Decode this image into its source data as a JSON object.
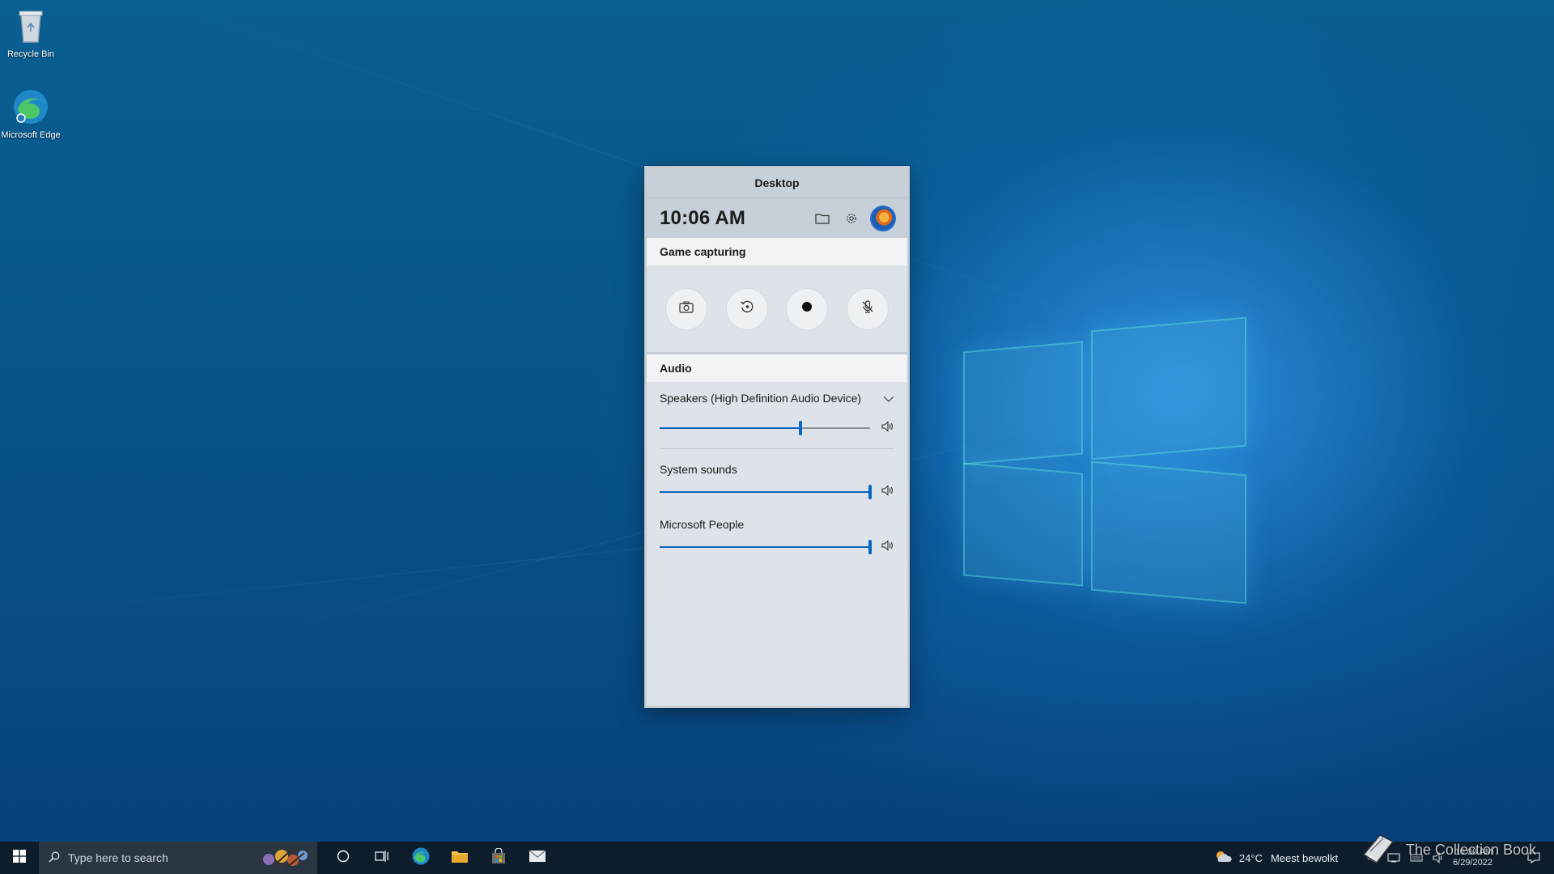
{
  "desktop": {
    "icons": [
      {
        "label": "Recycle Bin",
        "icon": "recycle-bin-icon"
      },
      {
        "label": "Microsoft Edge",
        "icon": "edge-icon"
      }
    ]
  },
  "widget": {
    "title": "Desktop",
    "time": "10:06 AM",
    "header_icons": [
      "folder-icon",
      "gear-icon",
      "avatar"
    ],
    "capture": {
      "heading": "Game capturing",
      "buttons": [
        "screenshot-camera-icon",
        "record-last-icon",
        "record-dot-icon",
        "mic-off-icon"
      ]
    },
    "audio": {
      "heading": "Audio",
      "device": "Speakers (High Definition Audio Device)",
      "master_volume": 0.67,
      "apps": [
        {
          "name": "System sounds",
          "volume": 1.0
        },
        {
          "name": "Microsoft People",
          "volume": 1.0
        }
      ]
    },
    "colors": {
      "accent": "#0a66c2",
      "panel": "#dde3e8",
      "header": "#c7d0d8"
    }
  },
  "taskbar": {
    "search_placeholder": "Type here to search",
    "weather": {
      "temp": "24°C",
      "text": "Meest bewolkt"
    },
    "date": "6/29/2022",
    "time": "10:06 AM"
  },
  "watermark": "The Collection Book"
}
